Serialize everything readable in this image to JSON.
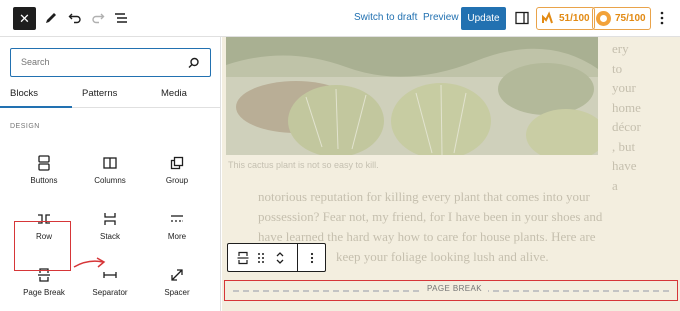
{
  "toolbar": {
    "close_icon": "close-icon",
    "switch_to_draft": "Switch to draft",
    "preview": "Preview",
    "update": "Update",
    "seo_score": "51/100",
    "readability_score": "75/100",
    "accent_color": "#2271b1",
    "score_color": "#e28a13"
  },
  "sidebar": {
    "search_placeholder": "Search",
    "tabs": [
      {
        "label": "Blocks",
        "active": true
      },
      {
        "label": "Patterns",
        "active": false
      },
      {
        "label": "Media",
        "active": false
      }
    ],
    "section_title": "DESIGN",
    "blocks": [
      {
        "label": "Buttons",
        "icon": "buttons-icon"
      },
      {
        "label": "Columns",
        "icon": "columns-icon"
      },
      {
        "label": "Group",
        "icon": "group-icon"
      },
      {
        "label": "Row",
        "icon": "row-icon"
      },
      {
        "label": "Stack",
        "icon": "stack-icon"
      },
      {
        "label": "More",
        "icon": "more-icon"
      },
      {
        "label": "Page Break",
        "icon": "page-break-icon",
        "highlighted": true
      },
      {
        "label": "Separator",
        "icon": "separator-icon"
      },
      {
        "label": "Spacer",
        "icon": "spacer-icon"
      }
    ]
  },
  "editor": {
    "image_caption": "This cactus plant is not so easy to kill.",
    "side_text": [
      "ery",
      "to",
      "your",
      "home",
      "décor",
      ", but",
      "have",
      "a"
    ],
    "paragraph_lines": [
      "notorious reputation for killing every plant that comes into your",
      "possession? Fear not, my friend, for I have been in your shoes and",
      "have learned the hard way how to care for house plants. Here are",
      "keep your foliage looking lush and alive."
    ],
    "page_break_label": "PAGE BREAK"
  }
}
